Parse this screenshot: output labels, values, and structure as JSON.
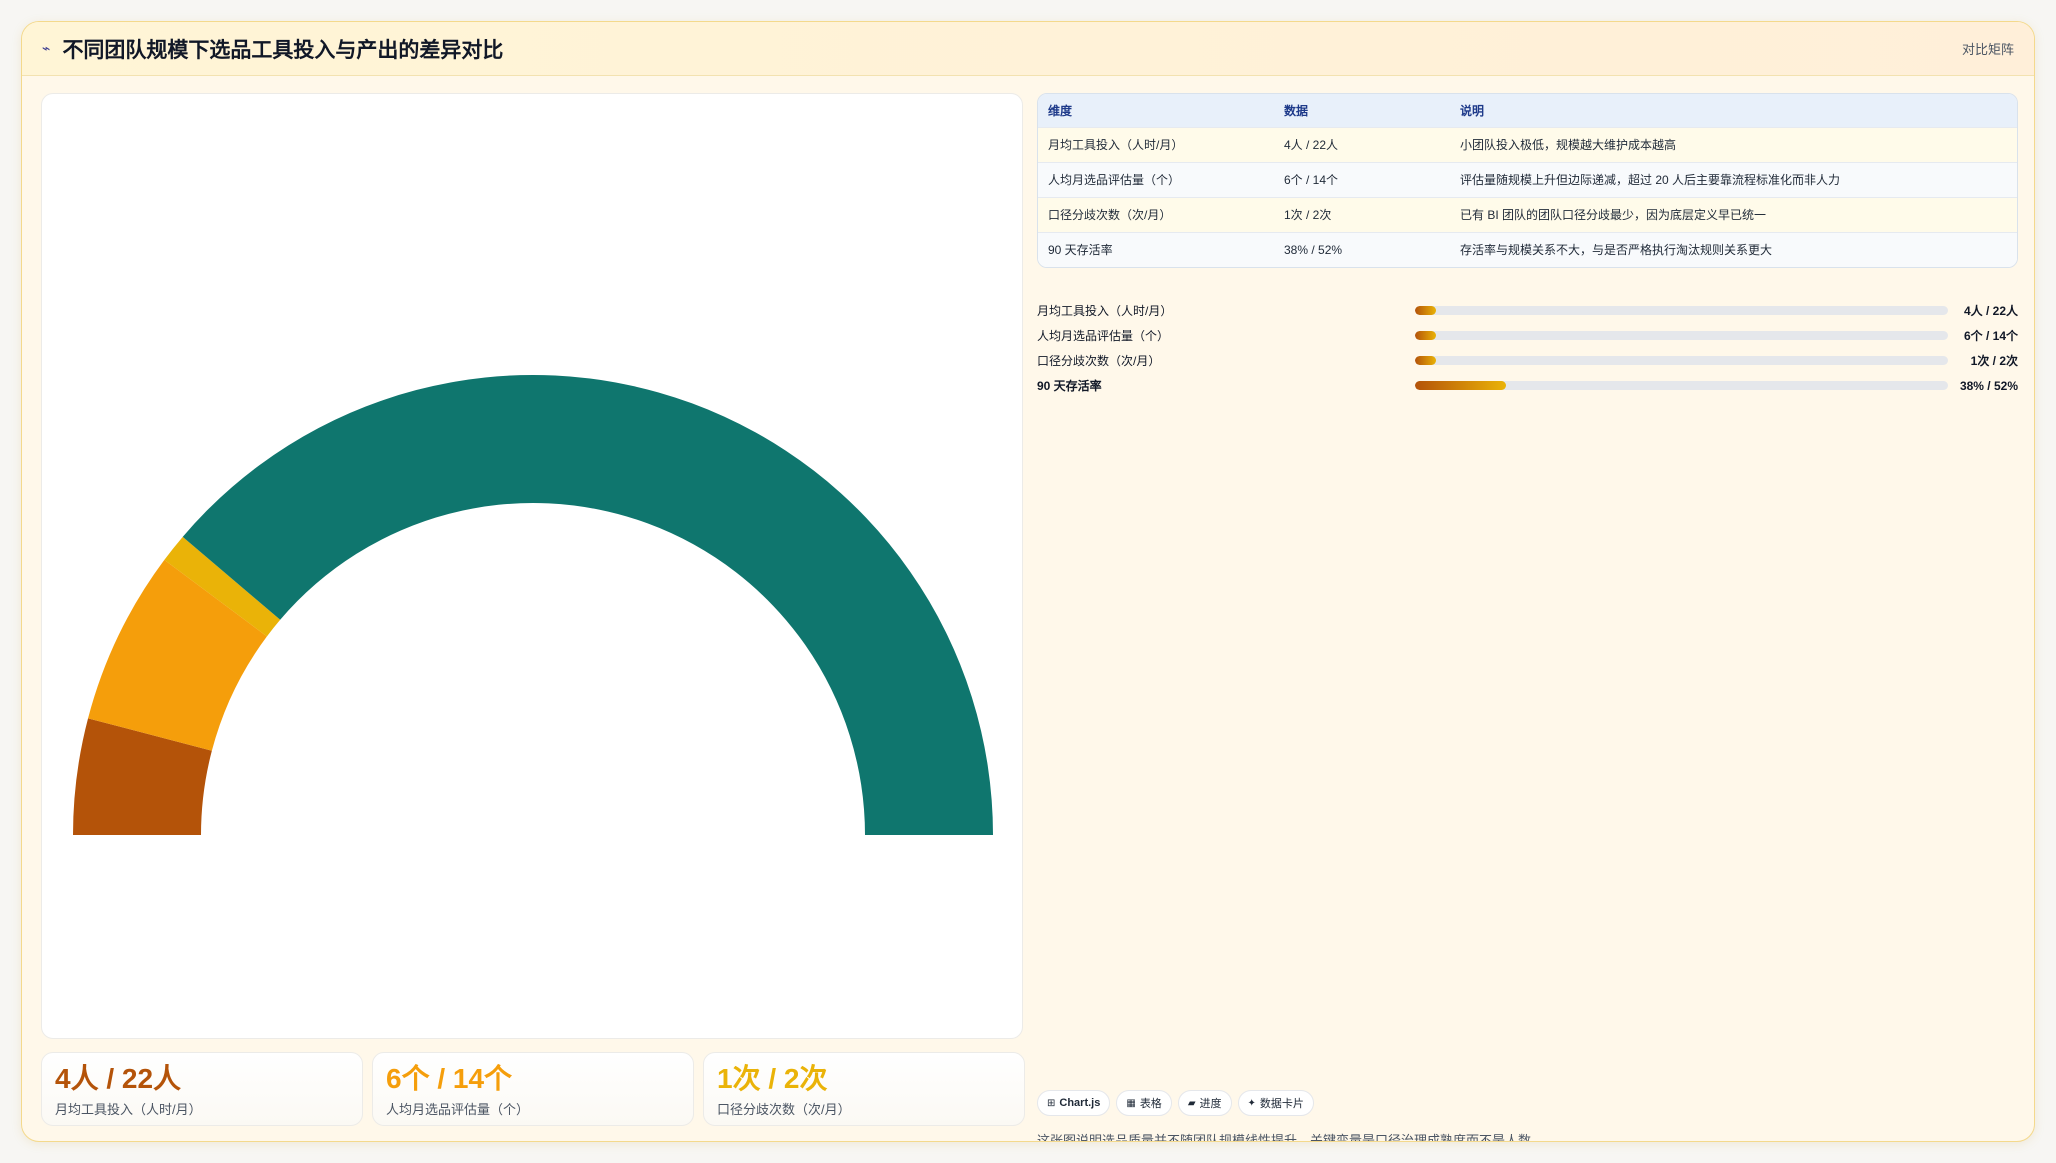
{
  "header": {
    "icon": "chart-line-icon",
    "title": "不同团队规模下选品工具投入与产出的差异对比",
    "tag": "对比矩阵"
  },
  "chart_data": {
    "type": "pie",
    "variant": "half-doughnut",
    "categories": [
      "月均工具投入（人时/月）",
      "人均月选品评估量（个）",
      "口径分歧次数（次/月）",
      "90 天存活率"
    ],
    "values": [
      4,
      6,
      1,
      38
    ],
    "colors": [
      "#b45309",
      "#f59e0b",
      "#eab308",
      "#0f766e"
    ]
  },
  "kpis": [
    {
      "value": "4人 / 22人",
      "label": "月均工具投入（人时/月）",
      "color": "#b45309"
    },
    {
      "value": "6个 / 14个",
      "label": "人均月选品评估量（个）",
      "color": "#f59e0b"
    },
    {
      "value": "1次 / 2次",
      "label": "口径分歧次数（次/月）",
      "color": "#eab308"
    }
  ],
  "table": {
    "headers": [
      "维度",
      "数据",
      "说明"
    ],
    "rows": [
      [
        "月均工具投入（人时/月）",
        "4人 / 22人",
        "小团队投入极低，规模越大维护成本越高"
      ],
      [
        "人均月选品评估量（个）",
        "6个 / 14个",
        "评估量随规模上升但边际递减，超过 20 人后主要靠流程标准化而非人力"
      ],
      [
        "口径分歧次数（次/月）",
        "1次 / 2次",
        "已有 BI 团队的团队口径分歧最少，因为底层定义早已统一"
      ],
      [
        "90 天存活率",
        "38% / 52%",
        "存活率与规模关系不大，与是否严格执行淘汰规则关系更大"
      ]
    ]
  },
  "bars": [
    {
      "label": "月均工具投入（人时/月）",
      "value": "4人 / 22人",
      "fraction": 0.04
    },
    {
      "label": "人均月选品评估量（个）",
      "value": "6个 / 14个",
      "fraction": 0.04
    },
    {
      "label": "口径分歧次数（次/月）",
      "value": "1次 / 2次",
      "fraction": 0.04
    },
    {
      "label": "90 天存活率",
      "value": "38% / 52%",
      "fraction": 0.17
    }
  ],
  "chips": [
    {
      "icon": "chart-icon",
      "label": "Chart.js"
    },
    {
      "icon": "table-icon",
      "label": "表格"
    },
    {
      "icon": "progress-icon",
      "label": "进度"
    },
    {
      "icon": "sparkle-icon",
      "label": "数据卡片"
    }
  ],
  "note": "这张图说明选品质量并不随团队规模线性提升，关键变量是口径治理成熟度而不是人数。"
}
